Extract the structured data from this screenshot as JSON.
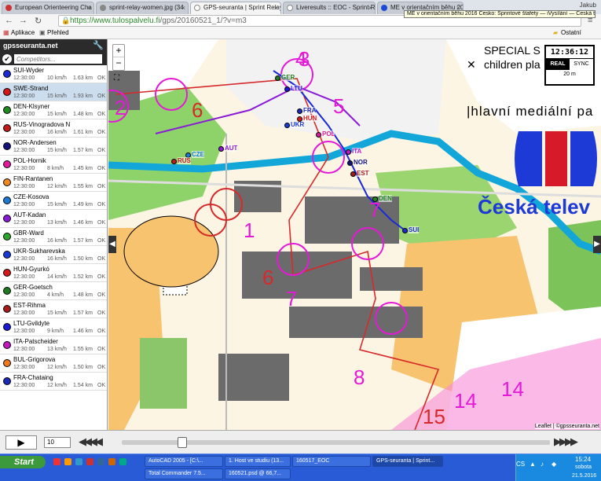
{
  "browser": {
    "tabs": [
      {
        "title": "European Orienteering Cha",
        "active": false
      },
      {
        "title": "sprint-relay-women.jpg (34",
        "active": false
      },
      {
        "title": "GPS-seuranta | Sprint Relay",
        "active": true
      },
      {
        "title": "Liveresults :: EOC - Sprint R",
        "active": false
      },
      {
        "title": "ME v orientačním běhu 2016",
        "active": false
      }
    ],
    "tooltip": "ME v orientačním běhu 2016 Česko: Sprintové štafety — iVysílání — Česká televize",
    "user": "Jakub",
    "url_host": "https://www.tulospalvelu.fi",
    "url_path": "/gps/20160521_1/?v=m3",
    "bookmarks": {
      "apps": "Aplikace",
      "overview": "Přehled",
      "other": "Ostatní záložky"
    }
  },
  "sidebar": {
    "brand": "gpsseuranta.net",
    "search_placeholder": "Competitors...",
    "competitors": [
      {
        "name": "SUI-Wyder",
        "time": "12:30:00",
        "speed": "10 km/h",
        "dist": "1.63 km",
        "status": "OK",
        "color": "#1a2bd6",
        "selected": false
      },
      {
        "name": "SWE-Strand",
        "time": "12:30:00",
        "speed": "15 km/h",
        "dist": "1.93 km",
        "status": "OK",
        "color": "#d81818",
        "selected": true
      },
      {
        "name": "DEN-Klsyner",
        "time": "12:30:00",
        "speed": "15 km/h",
        "dist": "1.48 km",
        "status": "OK",
        "color": "#1e8a1e",
        "selected": false
      },
      {
        "name": "RUS-Vinogradova N",
        "time": "12:30:00",
        "speed": "16 km/h",
        "dist": "1.61 km",
        "status": "OK",
        "color": "#c21a1a",
        "selected": false
      },
      {
        "name": "NOR-Andersen",
        "time": "12:30:00",
        "speed": "15 km/h",
        "dist": "1.57 km",
        "status": "OK",
        "color": "#13137a",
        "selected": false
      },
      {
        "name": "POL-Hornik",
        "time": "12:30:00",
        "speed": "8 km/h",
        "dist": "1.45 km",
        "status": "OK",
        "color": "#e2189a",
        "selected": false
      },
      {
        "name": "FIN-Rantanen",
        "time": "12:30:00",
        "speed": "12 km/h",
        "dist": "1.55 km",
        "status": "OK",
        "color": "#f08a1a",
        "selected": false
      },
      {
        "name": "CZE-Kosova",
        "time": "12:30:00",
        "speed": "15 km/h",
        "dist": "1.49 km",
        "status": "OK",
        "color": "#1a7ad6",
        "selected": false
      },
      {
        "name": "AUT-Kadan",
        "time": "12:30:00",
        "speed": "13 km/h",
        "dist": "1.46 km",
        "status": "OK",
        "color": "#8a1ad6",
        "selected": false
      },
      {
        "name": "GBR-Ward",
        "time": "12:30:00",
        "speed": "16 km/h",
        "dist": "1.57 km",
        "status": "OK",
        "color": "#2aa62a",
        "selected": false
      },
      {
        "name": "UKR-Sukharevska",
        "time": "12:30:00",
        "speed": "16 km/h",
        "dist": "1.50 km",
        "status": "OK",
        "color": "#1a3ad6",
        "selected": false
      },
      {
        "name": "HUN-Gyurkó",
        "time": "12:30:00",
        "speed": "14 km/h",
        "dist": "1.52 km",
        "status": "OK",
        "color": "#d61a1a",
        "selected": false
      },
      {
        "name": "GER-Goetsch",
        "time": "12:30:00",
        "speed": "4 km/h",
        "dist": "1.48 km",
        "status": "OK",
        "color": "#1e7a1e",
        "selected": false
      },
      {
        "name": "EST-Rihma",
        "time": "12:30:00",
        "speed": "15 km/h",
        "dist": "1.57 km",
        "status": "OK",
        "color": "#a61a1a",
        "selected": false
      },
      {
        "name": "LTU-Gvildyte",
        "time": "12:30:00",
        "speed": "9 km/h",
        "dist": "1.46 km",
        "status": "OK",
        "color": "#1a1ad6",
        "selected": false
      },
      {
        "name": "ITA-Patscheider",
        "time": "12:30:00",
        "speed": "13 km/h",
        "dist": "1.55 km",
        "status": "OK",
        "color": "#c218c2",
        "selected": false
      },
      {
        "name": "BUL-Grigorova",
        "time": "12:30:00",
        "speed": "12 km/h",
        "dist": "1.50 km",
        "status": "OK",
        "color": "#f07a1a",
        "selected": false
      },
      {
        "name": "FRA-Chataing",
        "time": "12:30:00",
        "speed": "12 km/h",
        "dist": "1.54 km",
        "status": "OK",
        "color": "#1a2ab6",
        "selected": false
      }
    ]
  },
  "map": {
    "zoom_in": "+",
    "zoom_out": "−",
    "clock": {
      "time": "12:36:12",
      "real": "REAL",
      "sync": "SYNC",
      "scale": "20 m"
    },
    "overlay_special": "SPECIAL S",
    "overlay_children": "children pla",
    "overlay_hlavni": "|hlavní mediální pa",
    "overlay_ceska": "Česká telev",
    "attribution": "Leaflet | ©gpsseuranta.net",
    "controls": [
      "1",
      "2",
      "3",
      "4",
      "5",
      "6",
      "6",
      "7",
      "7",
      "8",
      "14",
      "14",
      "15"
    ],
    "runner_labels": [
      "GER",
      "LTU",
      "FRA",
      "UKR",
      "HUN",
      "POL",
      "ITA",
      "NOR",
      "EST",
      "DEN",
      "SUI",
      "AUT",
      "CZE",
      "RUS"
    ]
  },
  "player": {
    "play": "▶",
    "speed": "10",
    "rewind": "◀◀◀◀",
    "forward": "▶▶▶▶",
    "progress": 0.13
  },
  "taskbar": {
    "start": "Start",
    "items": [
      "AutoCAD 2005 - [C:\\...",
      "1. Host ve studiu (13...",
      "160517_EOC",
      "GPS-seuranta | Sprint...",
      "Total Commander 7.5...",
      "160521.psd @ 66,7..."
    ],
    "lang": "CS",
    "time": "15:24",
    "day": "sobota",
    "date": "21.5.2016"
  }
}
